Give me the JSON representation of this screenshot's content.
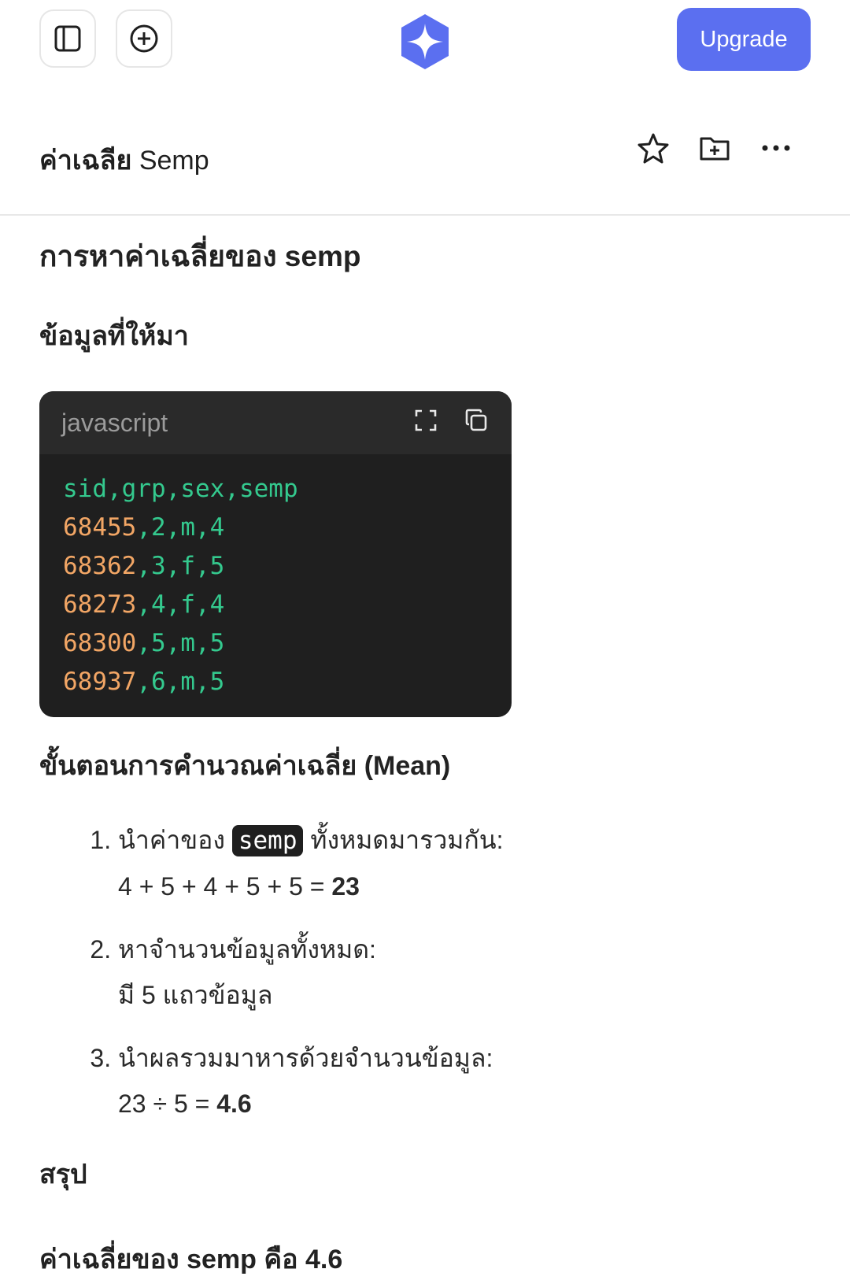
{
  "topbar": {
    "upgrade_label": "Upgrade",
    "accent_color": "#5b6ff0"
  },
  "chat": {
    "title_bold": "ค่าเฉลีย",
    "title_rest": " Semp"
  },
  "content": {
    "heading": "การหาค่าเฉลี่ยของ semp",
    "given_heading": "ข้อมูลที่ให้มา",
    "code": {
      "language": "javascript",
      "header_line": "sid,grp,sex,semp",
      "rows": [
        {
          "sid": "68455",
          "rest": ",2,m,4"
        },
        {
          "sid": "68362",
          "rest": ",3,f,5"
        },
        {
          "sid": "68273",
          "rest": ",4,f,4"
        },
        {
          "sid": "68300",
          "rest": ",5,m,5"
        },
        {
          "sid": "68937",
          "rest": ",6,m,5"
        }
      ]
    },
    "steps_heading": "ขั้นตอนการคำนวณค่าเฉลี่ย (Mean)",
    "steps": [
      {
        "prefix": "นำค่าของ",
        "code": "semp",
        "suffix": "ทั้งหมดมารวมกัน:",
        "detail_plain": "4 + 5 + 4 + 5 + 5 = ",
        "detail_bold": "23"
      },
      {
        "prefix": "หาจำนวนข้อมูลทั้งหมด:",
        "detail_plain": "มี 5 แถวข้อมูล"
      },
      {
        "prefix": "นำผลรวมมาหารด้วยจำนวนข้อมูล:",
        "detail_plain": "23 ÷ 5 = ",
        "detail_bold": "4.6"
      }
    ],
    "summary_heading": "สรุป",
    "summary_text": "ค่าเฉลี่ยของ semp คือ 4.6"
  }
}
